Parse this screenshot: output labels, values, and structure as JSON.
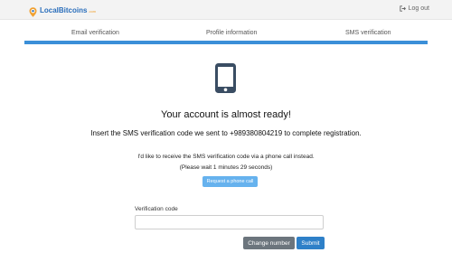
{
  "header": {
    "logo_text": "LocalBitcoins",
    "logo_tld": ".com",
    "logout_label": "Log out",
    "logout_icon": "logout-icon"
  },
  "steps": {
    "items": [
      {
        "label": "Email verification"
      },
      {
        "label": "Profile information"
      },
      {
        "label": "SMS verification"
      }
    ],
    "progress_fraction": 1.0,
    "progress_color": "#3b8fd8"
  },
  "main": {
    "icon": "mobile-phone-icon",
    "headline": "Your account is almost ready!",
    "instruction": "Insert the SMS verification code we sent to +989380804219 to complete registration.",
    "call_note": "I'd like to receive the SMS verification code via a phone call instead.",
    "wait_note": "(Please wait 1 minutes 29 seconds)",
    "request_call_label": "Request a phone call"
  },
  "form": {
    "code_label": "Verification code",
    "code_value": "",
    "code_placeholder": "",
    "change_number_label": "Change number",
    "submit_label": "Submit"
  },
  "colors": {
    "accent": "#3b8fd8",
    "submit": "#2e80c8",
    "secondary": "#6c757d",
    "call_button": "#66b2ee"
  }
}
